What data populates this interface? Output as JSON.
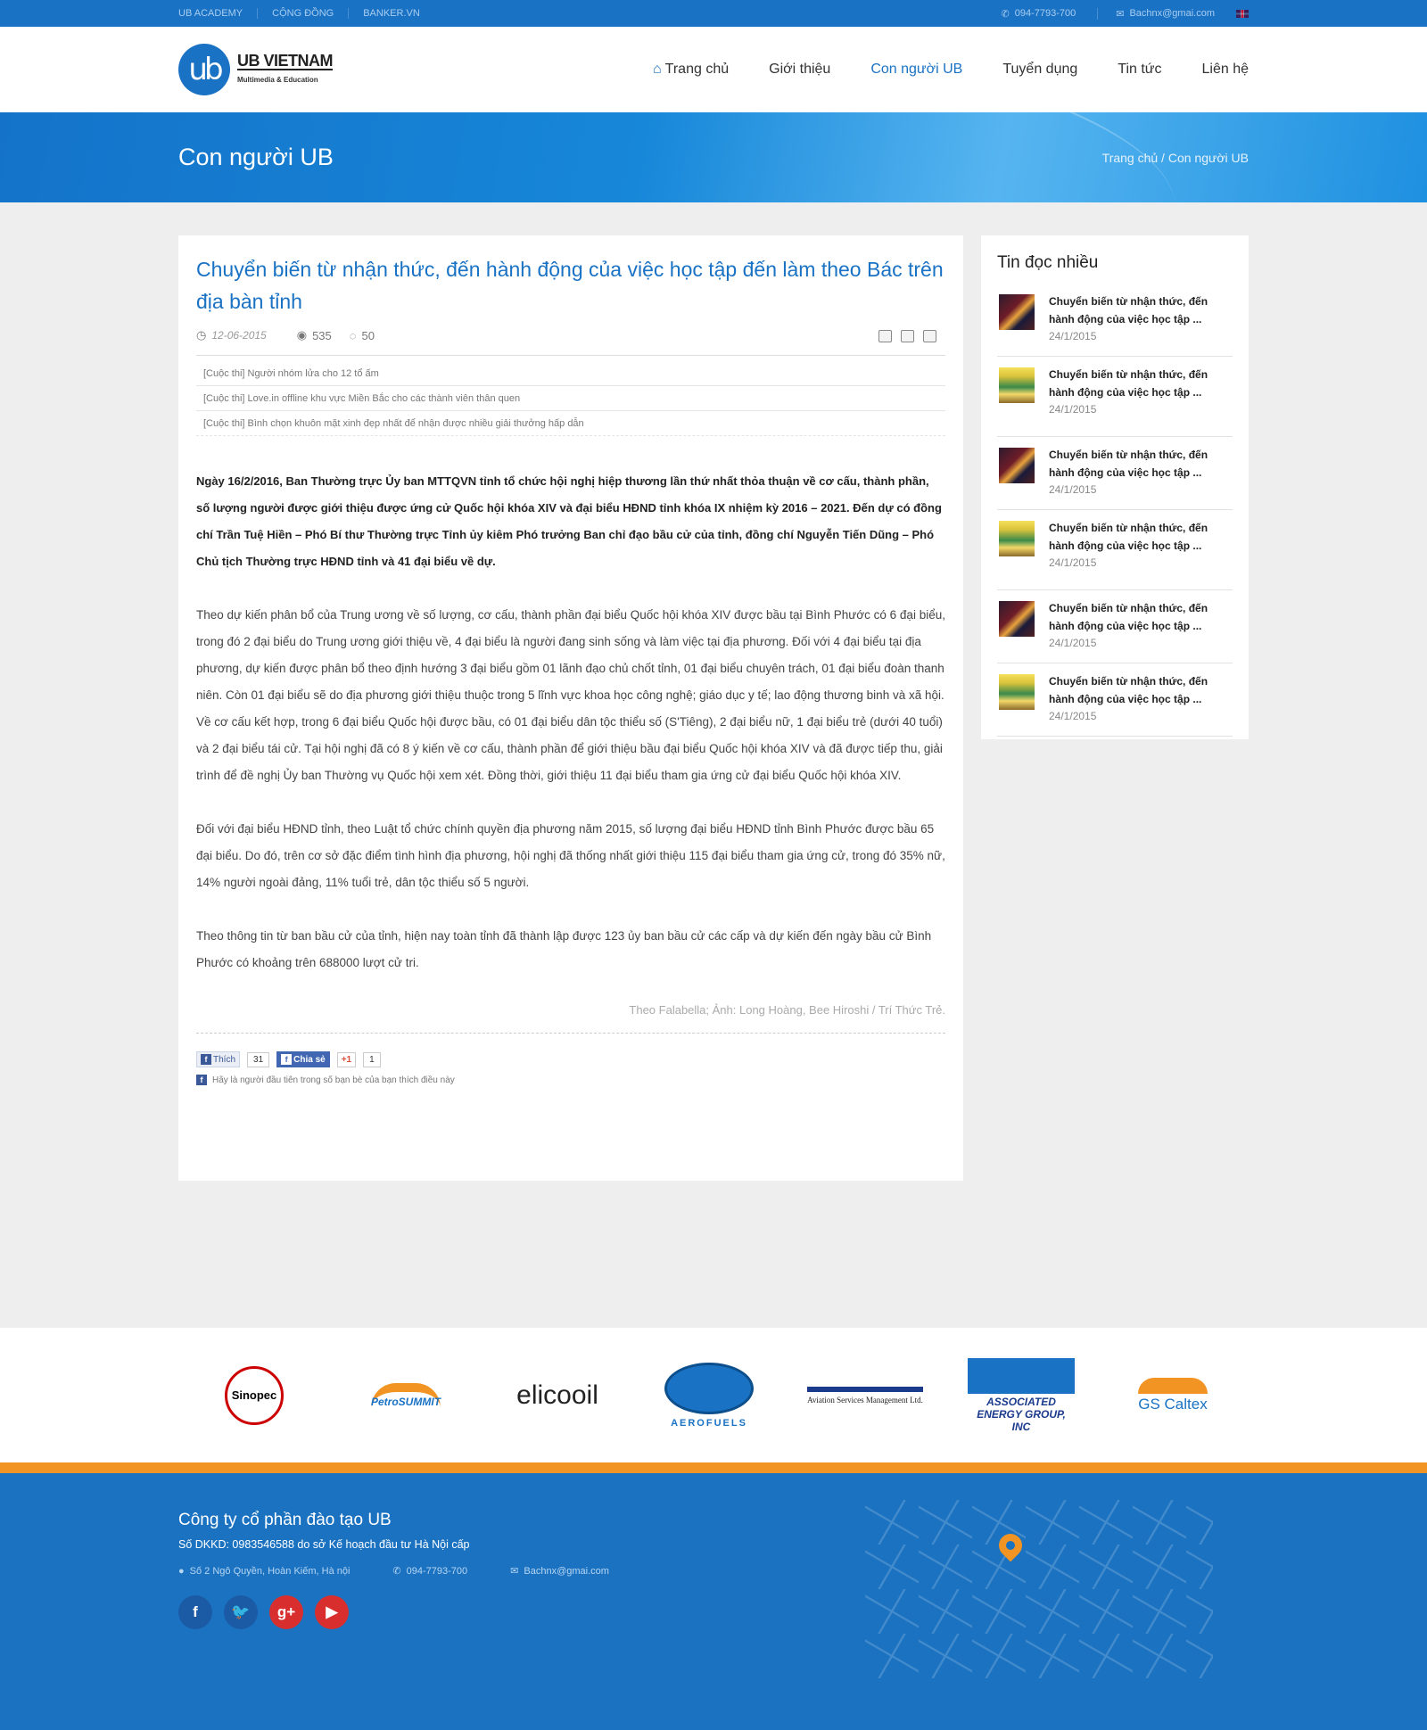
{
  "topbar": {
    "links": [
      "UB ACADEMY",
      "CỘNG ĐỒNG",
      "BANKER.VN"
    ],
    "phone": "094-7793-700",
    "email": "Bachnx@gmai.com"
  },
  "logo": {
    "mark": "ub",
    "name": "UB VIETNAM",
    "tagline": "Multimedia & Education"
  },
  "nav": [
    "Trang chủ",
    "Giới thiệu",
    "Con người UB",
    "Tuyển dụng",
    "Tin tức",
    "Liên hệ"
  ],
  "banner": {
    "title": "Con người UB",
    "breadcrumb": "Trang chủ / Con người UB"
  },
  "article": {
    "title": "Chuyển biến từ nhận thức, đến hành động của việc học tập đến làm theo Bác trên địa bàn tỉnh",
    "date": "12-06-2015",
    "views": "535",
    "comments": "50",
    "related": [
      "[Cuộc thi] Người nhóm lửa cho 12 tổ ấm",
      "[Cuộc thi]  Love.in offline khu vực Miền Bắc cho các thành viên thân quen",
      "[Cuộc thi] Bình chọn khuôn mặt xinh đẹp nhất để nhận được nhiều giải thưởng hấp dẫn"
    ],
    "lead": "Ngày 16/2/2016, Ban Thường trực Ủy ban MTTQVN tỉnh tổ chức hội nghị hiệp thương lần thứ nhất thỏa thuận về cơ cấu, thành phần, số lượng người được giới thiệu được ứng cử Quốc hội khóa XIV và đại biểu HĐND tỉnh khóa IX nhiệm kỳ 2016 – 2021. Đến dự có đồng chí Trần Tuệ Hiền – Phó Bí thư Thường trực Tỉnh ủy kiêm Phó trưởng Ban chỉ đạo bầu cử của tỉnh, đồng chí Nguyễn Tiến Dũng – Phó Chủ tịch Thường trực HĐND tỉnh và 41 đại biểu về dự.",
    "paragraphs": [
      "Theo dự kiến phân bổ của Trung ương về số lượng, cơ cấu, thành phần đại biểu Quốc hội khóa XIV được bầu tại Bình Phước có 6 đại biểu, trong đó 2 đại biểu do Trung ương giới thiệu về, 4 đại biểu là người đang sinh sống và làm việc tại địa phương. Đối với 4 đại biểu tại địa phương, dự kiến được phân bổ theo định hướng 3 đại biểu gồm 01 lãnh đạo chủ chốt tỉnh, 01 đại biểu chuyên trách, 01 đại biểu đoàn thanh niên. Còn 01 đại biểu sẽ do địa phương giới thiệu thuộc trong 5 lĩnh vực khoa học công nghệ; giáo dục y tế; lao động thương binh và xã hội. Về cơ cấu kết hợp, trong 6 đại biểu Quốc hội được bầu, có 01 đại biểu dân tộc thiểu số (S'Tiêng), 2 đại biểu nữ, 1 đại biểu trẻ (dưới 40 tuổi) và 2 đại biểu tái cử. Tại hội nghị đã có 8 ý kiến về cơ cấu, thành phần để giới thiệu bầu đại biểu Quốc hội khóa XIV và đã được tiếp thu, giải trình để đề nghị Ủy ban Thường vụ Quốc hội xem xét.  Đồng thời, giới thiệu 11 đại biểu tham gia ứng cử đại biểu Quốc hội khóa XIV.",
      "Đối với đại biểu HĐND tỉnh, theo Luật tổ chức chính quyền địa phương năm 2015, số lượng đại biểu HĐND tỉnh Bình Phước được bầu 65 đại biểu. Do đó, trên cơ sở đặc điểm tình hình địa phương, hội nghị đã thống nhất giới thiệu 115 đại biểu tham gia ứng cử, trong đó 35% nữ, 14% người ngoài đảng, 11% tuổi trẻ, dân tộc thiểu số 5 người.",
      "Theo thông tin từ ban bầu cử của tỉnh, hiện nay toàn tỉnh đã thành lập được 123 ủy ban bầu cử các cấp và dự kiến đến ngày bầu cử Bình Phước có khoảng trên 688000 lượt cử tri."
    ],
    "source": "Theo Falabella; Ảnh: Long Hoàng, Bee Hiroshi / Trí Thức Trẻ.",
    "social": {
      "like": "Thích",
      "like_count": "31",
      "share": "Chia sẻ",
      "gplus": "+1",
      "gplus_count": "1",
      "note": "Hãy là người đầu tiên trong số bạn bè của bạn thích điều này"
    }
  },
  "sidebar": {
    "title": "Tin đọc nhiều",
    "items": [
      {
        "title": "Chuyển biến từ nhận thức, đến hành động của việc học tập ...",
        "date": "24/1/2015"
      },
      {
        "title": "Chuyển biến từ nhận thức, đến hành động của việc học tập ...",
        "date": "24/1/2015"
      },
      {
        "title": "Chuyển biến từ nhận thức, đến hành động của việc học tập ...",
        "date": "24/1/2015"
      },
      {
        "title": "Chuyển biến từ nhận thức, đến hành động của việc học tập ...",
        "date": "24/1/2015"
      },
      {
        "title": "Chuyển biến từ nhận thức, đến hành động của việc học tập ...",
        "date": "24/1/2015"
      },
      {
        "title": "Chuyển biến từ nhận thức, đến hành động của việc học tập ...",
        "date": "24/1/2015"
      }
    ]
  },
  "partners": [
    "Sinopec",
    "PetroSUMMIT",
    "elicooil",
    "AEROFUELS",
    "Aviation Services Management Ltd.",
    "ASSOCIATED ENERGY GROUP, INC",
    "GS Caltex"
  ],
  "footer": {
    "company": "Công ty cổ phần đào tạo UB",
    "registration": "Số DKKD: 0983546588 do sở Kế hoạch đầu tư  Hà Nội cấp",
    "address": "Số 2 Ngô Quyền, Hoàn Kiếm, Hà nội",
    "phone": "094-7793-700",
    "email": "Bachnx@gmai.com",
    "social_icons": [
      "facebook-icon",
      "twitter-icon",
      "google-plus-icon",
      "youtube-icon"
    ]
  },
  "colors": {
    "primary": "#1a72c4",
    "accent": "#f29423"
  }
}
